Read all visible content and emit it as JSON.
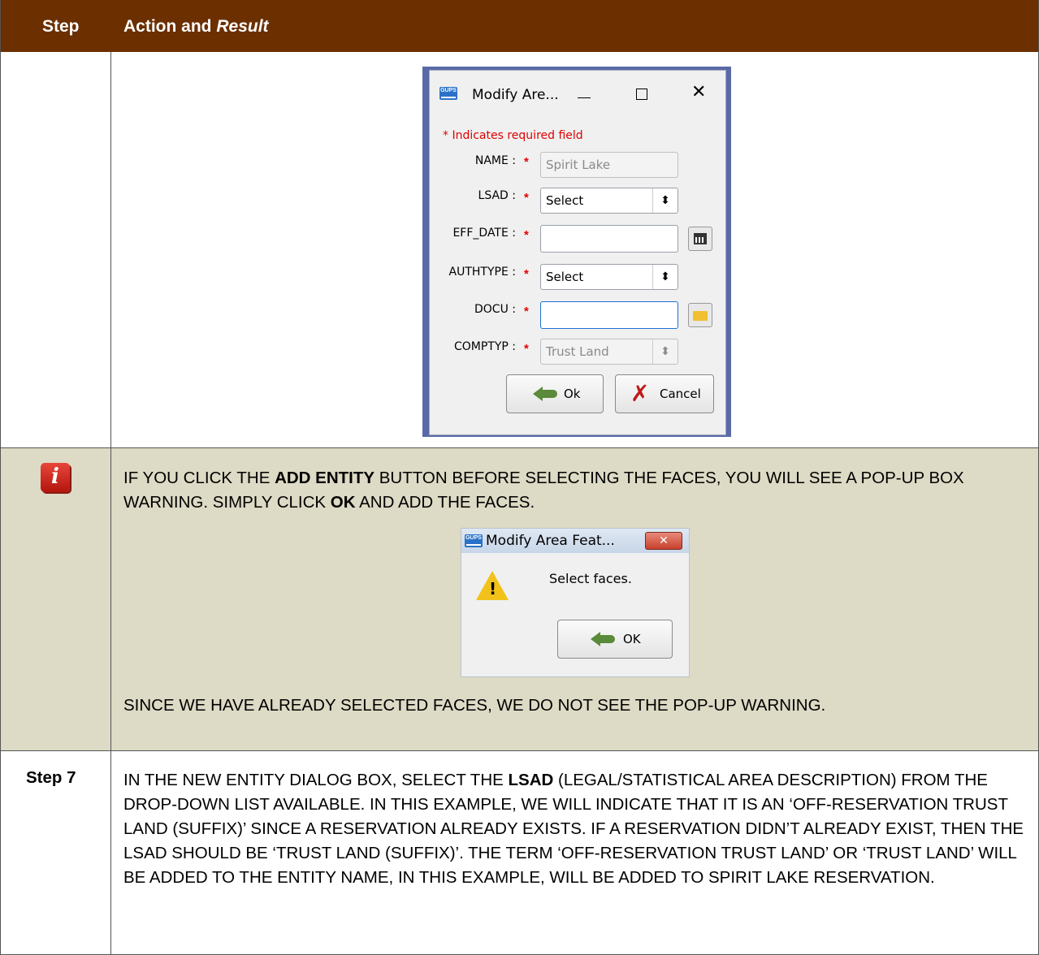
{
  "header": {
    "step": "Step",
    "action_prefix": "Action and ",
    "action_italic": "Result"
  },
  "dialog1": {
    "title": "Modify Are...",
    "app_badge": "GUPS",
    "min_glyph": "—",
    "max_glyph": "☐",
    "close_glyph": "✕",
    "required_note": "* Indicates required field",
    "fields": {
      "name_label": "NAME :",
      "name_value": "Spirit Lake",
      "lsad_label": "LSAD :",
      "lsad_value": "Select",
      "effdate_label": "EFF_DATE :",
      "effdate_value": "",
      "authtype_label": "AUTHTYPE :",
      "authtype_value": "Select",
      "docu_label": "DOCU :",
      "docu_value": "",
      "comptyp_label": "COMPTYP :",
      "comptyp_value": "Trust Land"
    },
    "star": "*",
    "select_arrow": "⬍",
    "ok_label": "Ok",
    "cancel_label": "Cancel"
  },
  "note": {
    "info_glyph": "i",
    "p1_a": "IF YOU CLICK THE ",
    "p1_b": "ADD ENTITY",
    "p1_c": " BUTTON BEFORE SELECTING THE FACES, YOU WILL SEE A POP-UP BOX WARNING. SIMPLY CLICK ",
    "p1_d": "OK",
    "p1_e": " AND ADD THE FACES.",
    "p2": "SINCE WE HAVE ALREADY SELECTED FACES, WE DO NOT SEE THE POP-UP WARNING."
  },
  "dialog2": {
    "title": "Modify Area Feat...",
    "app_badge": "GUPS",
    "close_glyph": "✕",
    "warn_glyph": "!",
    "message": "Select faces.",
    "ok_label": "OK"
  },
  "step7": {
    "label": "Step 7",
    "t_a": "IN THE NEW ENTITY DIALOG BOX, SELECT THE ",
    "t_b": "LSAD",
    "t_c": " (LEGAL/STATISTICAL AREA DESCRIPTION) FROM THE DROP-DOWN LIST AVAILABLE. IN THIS EXAMPLE, WE WILL INDICATE THAT IT IS AN ‘OFF-RESERVATION TRUST LAND (SUFFIX)’ SINCE A RESERVATION ALREADY EXISTS. IF A RESERVATION DIDN’T ALREADY EXIST, THEN THE LSAD SHOULD BE ‘TRUST LAND (SUFFIX)’. THE TERM ‘OFF-RESERVATION TRUST LAND’ OR ‘TRUST LAND’ WILL BE ADDED TO THE ENTITY NAME, IN THIS EXAMPLE, WILL BE ADDED TO SPIRIT LAKE RESERVATION."
  }
}
